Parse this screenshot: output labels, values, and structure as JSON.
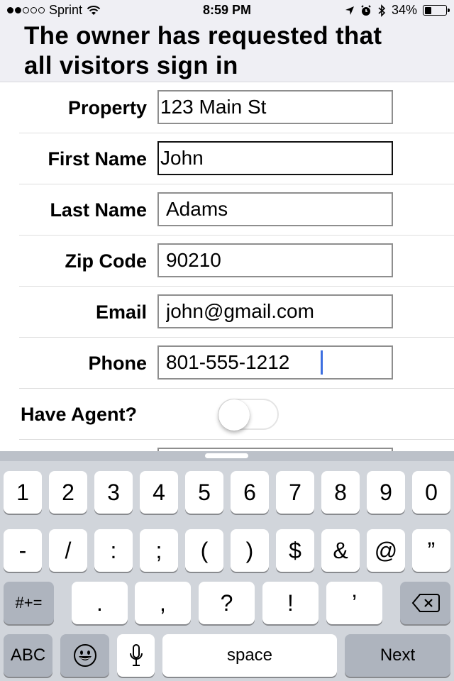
{
  "status_bar": {
    "signal_bars_filled": 2,
    "signal_bars_total": 5,
    "carrier": "Sprint",
    "time": "8:59 PM",
    "battery_percent_label": "34%",
    "battery_level": 0.34,
    "icons": [
      "wifi-icon",
      "location-arrow-icon",
      "alarm-icon",
      "bluetooth-icon",
      "battery-icon"
    ]
  },
  "header": {
    "title_line1": "The owner has requested that",
    "title_line2": "all visitors sign in"
  },
  "form": {
    "fields": [
      {
        "label": "Property",
        "value": "123 Main St"
      },
      {
        "label": "First Name",
        "value": "John"
      },
      {
        "label": "Last Name",
        "value": "Adams"
      },
      {
        "label": "Zip Code",
        "value": "90210"
      },
      {
        "label": "Email",
        "value": "john@gmail.com"
      },
      {
        "label": "Phone",
        "value": "801-555-1212"
      }
    ],
    "agent_toggle": {
      "label": "Have Agent?",
      "on": false
    }
  },
  "keyboard": {
    "row1": [
      "1",
      "2",
      "3",
      "4",
      "5",
      "6",
      "7",
      "8",
      "9",
      "0"
    ],
    "row2": [
      "-",
      "/",
      ":",
      ";",
      "(",
      ")",
      "$",
      "&",
      "@",
      "”"
    ],
    "row3": {
      "shift_label": "#+=",
      "keys": [
        ".",
        ",",
        "?",
        "!",
        "’"
      ],
      "delete_icon": "backspace-icon"
    },
    "row4": {
      "abc_label": "ABC",
      "emoji_icon": "emoji-icon",
      "mic_icon": "microphone-icon",
      "space_label": "space",
      "next_label": "Next"
    }
  }
}
